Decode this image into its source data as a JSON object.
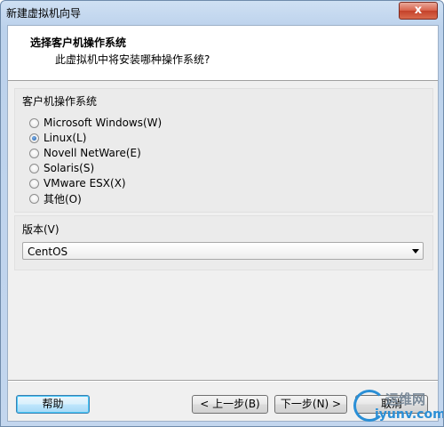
{
  "window": {
    "title": "新建虚拟机向导",
    "close_label": "x"
  },
  "header": {
    "title": "选择客户机操作系统",
    "subtitle": "此虚拟机中将安装哪种操作系统?"
  },
  "os_group": {
    "label": "客户机操作系统",
    "options": [
      {
        "label": "Microsoft Windows(W)",
        "checked": false
      },
      {
        "label": "Linux(L)",
        "checked": true
      },
      {
        "label": "Novell NetWare(E)",
        "checked": false
      },
      {
        "label": "Solaris(S)",
        "checked": false
      },
      {
        "label": "VMware ESX(X)",
        "checked": false
      },
      {
        "label": "其他(O)",
        "checked": false
      }
    ]
  },
  "version_group": {
    "label": "版本(V)",
    "selected": "CentOS"
  },
  "buttons": {
    "help": "帮助",
    "back": "< 上一步(B)",
    "next": "下一步(N) >",
    "cancel": "取消"
  },
  "watermark": {
    "cn_text": "运维网",
    "url": "iyunv.com"
  }
}
